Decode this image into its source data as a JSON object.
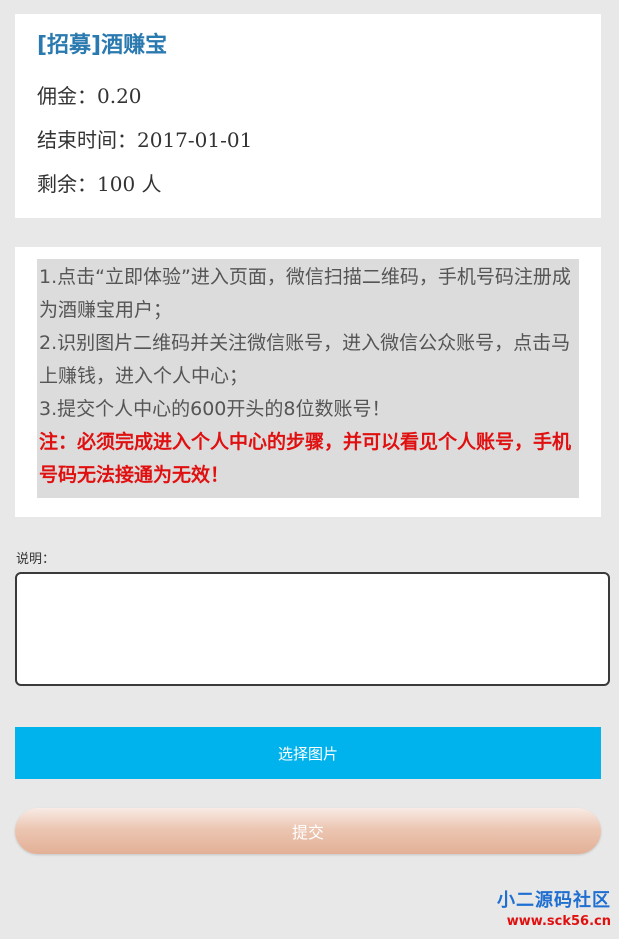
{
  "task": {
    "title": "[招募]酒赚宝",
    "commission_label": "佣金：",
    "commission_value": "0.20",
    "end_time_label": "结束时间：",
    "end_time_value": "2017-01-01",
    "remaining_label": "剩余：",
    "remaining_value": "100 人"
  },
  "steps": {
    "step1": "1.点击“立即体验”进入页面，微信扫描二维码，手机号码注册成为酒赚宝用户；",
    "step2": "2.识别图片二维码并关注微信账号，进入微信公众账号，点击马上赚钱，进入个人中心；",
    "step3": "3.提交个人中心的600开头的8位数账号！",
    "warning": "注：必须完成进入个人中心的步骤，并可以看见个人账号，手机号码无法接通为无效！"
  },
  "form": {
    "description_label": "说明：",
    "description_value": "",
    "choose_image_label": "选择图片",
    "submit_label": "提交"
  },
  "watermark": {
    "name": "小二源码社区",
    "url": "www.sck56.cn"
  },
  "colors": {
    "title_blue": "#2a7ab0",
    "warning_red": "#e01010",
    "pick_button": "#00b3ec",
    "submit_button": "#e2b096"
  }
}
